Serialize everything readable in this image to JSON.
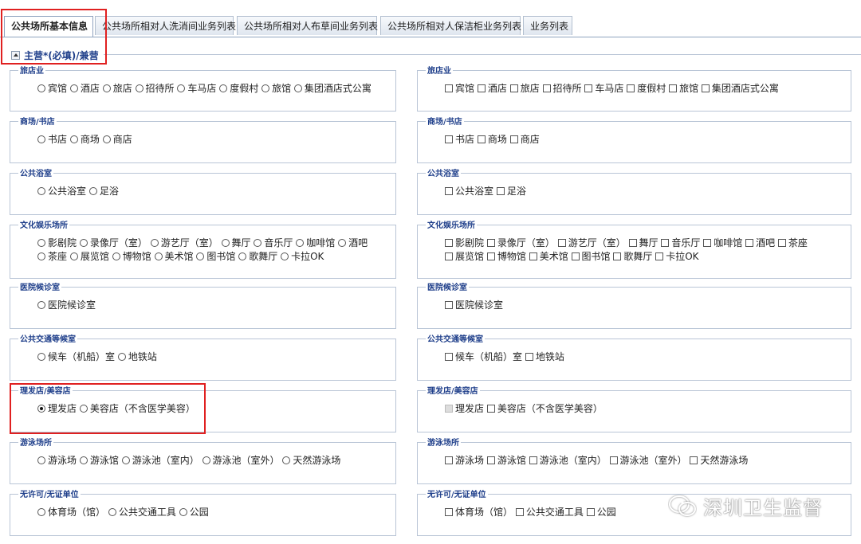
{
  "tabs": [
    {
      "label": "公共场所基本信息",
      "active": true
    },
    {
      "label": "公共场所相对人洗消间业务列表",
      "active": false
    },
    {
      "label": "公共场所相对人布草间业务列表",
      "active": false
    },
    {
      "label": "公共场所相对人保洁柜业务列表",
      "active": false
    },
    {
      "label": "业务列表",
      "active": false
    }
  ],
  "section": {
    "title": "主营*(必填)/兼营"
  },
  "groups": [
    {
      "title": "旅店业",
      "options": [
        "宾馆",
        "酒店",
        "旅店",
        "招待所",
        "车马店",
        "度假村",
        "旅馆",
        "集团酒店式公寓"
      ]
    },
    {
      "title": "商场/书店",
      "options": [
        "书店",
        "商场",
        "商店"
      ]
    },
    {
      "title": "公共浴室",
      "options": [
        "公共浴室",
        "足浴"
      ]
    },
    {
      "title": "文化娱乐场所",
      "options": [
        "影剧院",
        "录像厅（室）",
        "游艺厅（室）",
        "舞厅",
        "音乐厅",
        "咖啡馆",
        "酒吧",
        "茶座",
        "展览馆",
        "博物馆",
        "美术馆",
        "图书馆",
        "歌舞厅",
        "卡拉OK"
      ]
    },
    {
      "title": "医院候诊室",
      "options": [
        "医院候诊室"
      ]
    },
    {
      "title": "公共交通等候室",
      "options": [
        "候车（机船）室",
        "地铁站"
      ]
    },
    {
      "title": "理发店/美容店",
      "options": [
        "理发店",
        "美容店（不含医学美容）"
      ]
    },
    {
      "title": "游泳场所",
      "options": [
        "游泳场",
        "游泳馆",
        "游泳池（室内）",
        "游泳池（室外）",
        "天然游泳场"
      ]
    },
    {
      "title": "无许可/无证单位",
      "options": [
        "体育场（馆）",
        "公共交通工具",
        "公园"
      ]
    }
  ],
  "main_selected": {
    "group": 6,
    "option": 0
  },
  "secondary_disabled": {
    "group": 6,
    "option": 0
  },
  "watermark": "深圳卫生监督"
}
